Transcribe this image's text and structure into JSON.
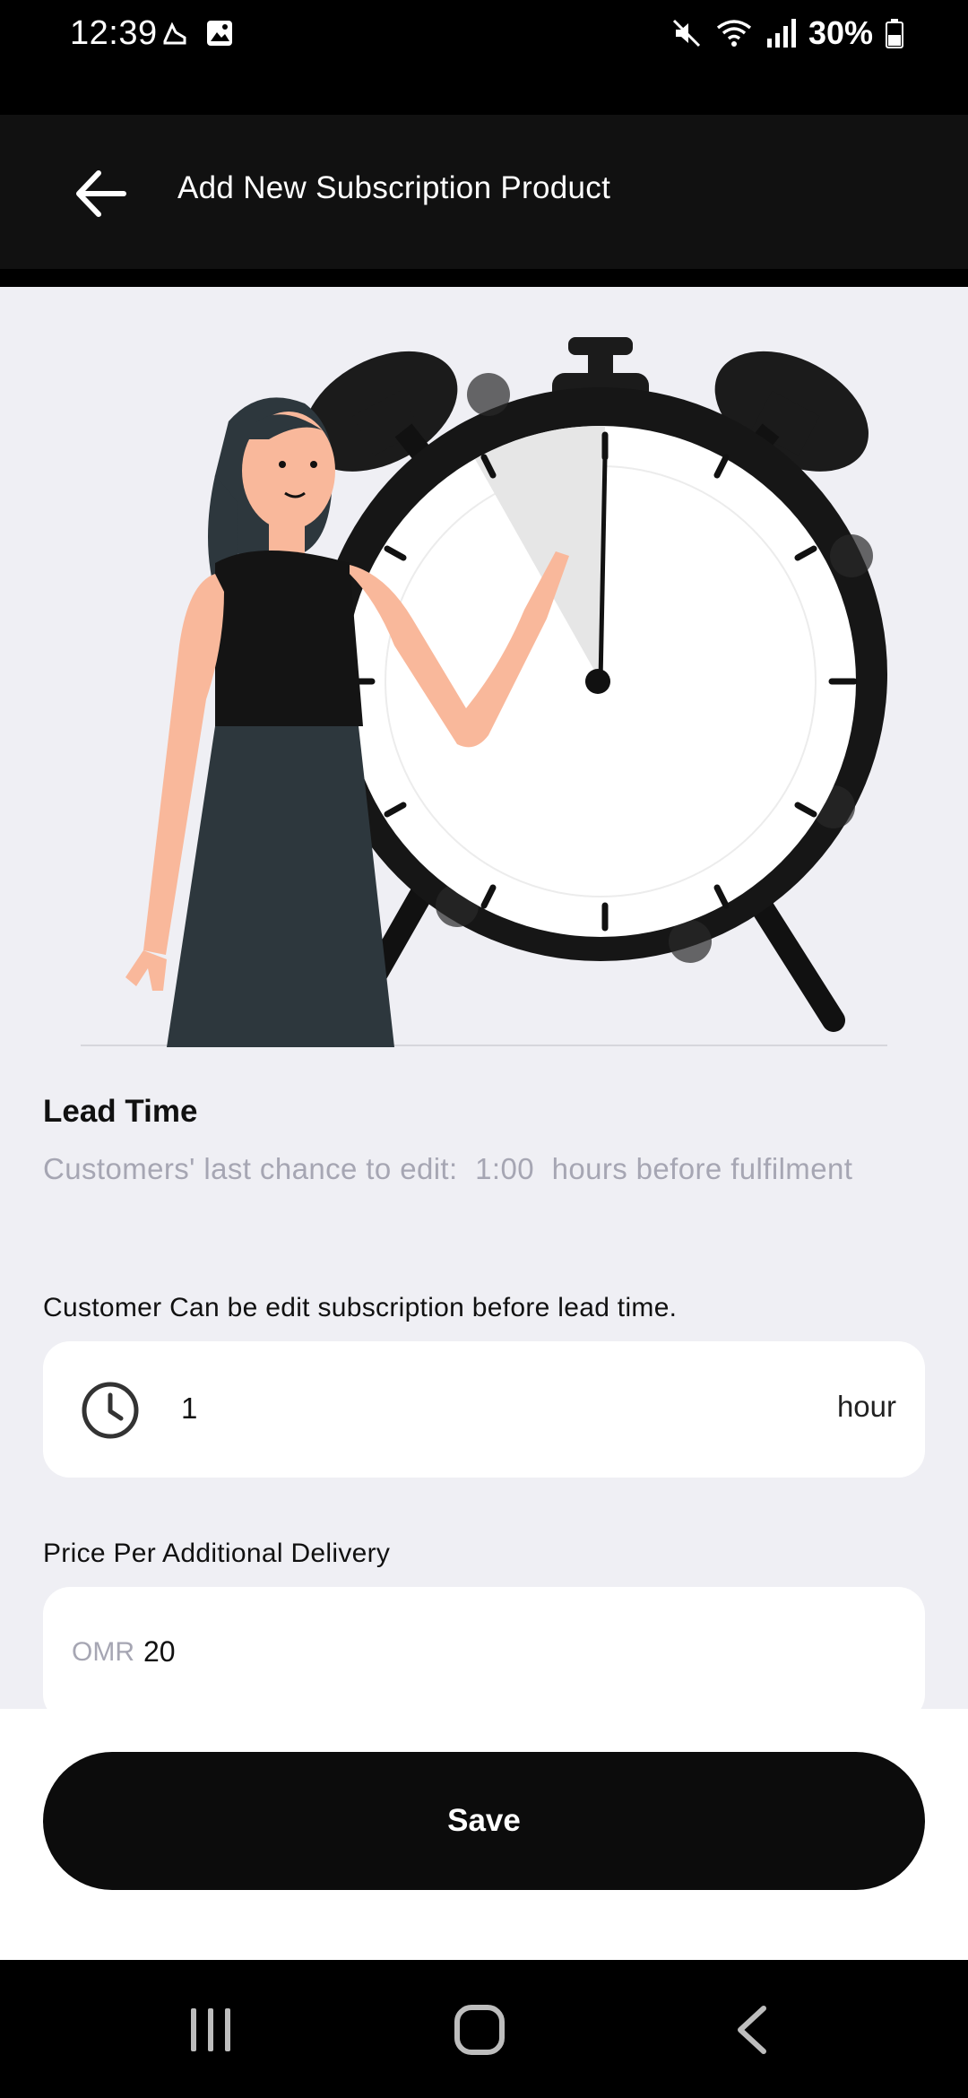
{
  "status_bar": {
    "time": "12:39",
    "battery": "30%",
    "left_icons": [
      "sport-app-icon",
      "image-icon"
    ],
    "right_icons": [
      "mute-icon",
      "wifi-icon",
      "signal-icon",
      "battery-icon"
    ]
  },
  "app_bar": {
    "title": "Add New Subscription Product",
    "back_icon": "arrow-left-icon"
  },
  "lead_time": {
    "title": "Lead Time",
    "desc_prefix": "Customers' last chance to edit:",
    "desc_value": "1:00",
    "desc_suffix": "hours before fulfilment",
    "field_label": "Customer Can be edit subscription before lead time.",
    "value": "1",
    "unit": "hour"
  },
  "price": {
    "label": "Price Per Additional Delivery",
    "currency": "OMR",
    "value": "20"
  },
  "actions": {
    "save_label": "Save"
  },
  "nav_bar": {
    "items": [
      "recents-icon",
      "home-icon",
      "back-icon"
    ]
  },
  "colors": {
    "primary": "#0c0c0c",
    "background": "#efeff4",
    "muted_text": "#a6a6b3",
    "skin": "#f9b89b"
  }
}
